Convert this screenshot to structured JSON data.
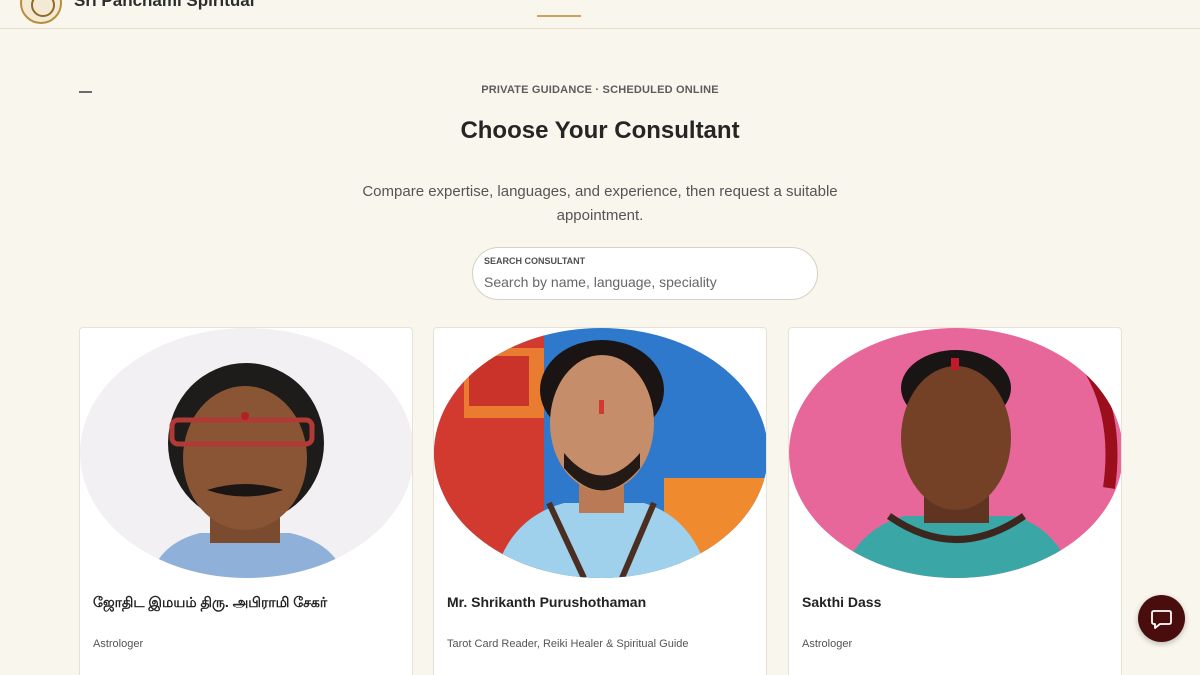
{
  "header": {
    "brand": "Sri Panchami Spiritual",
    "logo_icon": "temple-emblem-icon"
  },
  "hero": {
    "eyebrow": "PRIVATE GUIDANCE · SCHEDULED ONLINE",
    "title": "Choose Your Consultant",
    "subtitle": "Compare expertise, languages, and experience, then request a suitable appointment."
  },
  "search": {
    "label": "SEARCH CONSULTANT",
    "placeholder": "Search by name, language, speciality",
    "value": ""
  },
  "consultants": [
    {
      "name": "ஜோதிட இமயம் திரு. அபிராமி சேகர்",
      "role": "Astrologer"
    },
    {
      "name": "Mr. Shrikanth Purushothaman",
      "role": "Tarot Card Reader, Reiki Healer & Spiritual Guide"
    },
    {
      "name": "Sakthi Dass",
      "role": "Astrologer"
    }
  ],
  "chat_button": {
    "icon": "chat-bubble-icon"
  },
  "colors": {
    "background": "#f9f6ee",
    "accent": "#c9a55a",
    "chat_button": "#4a0d0d"
  }
}
